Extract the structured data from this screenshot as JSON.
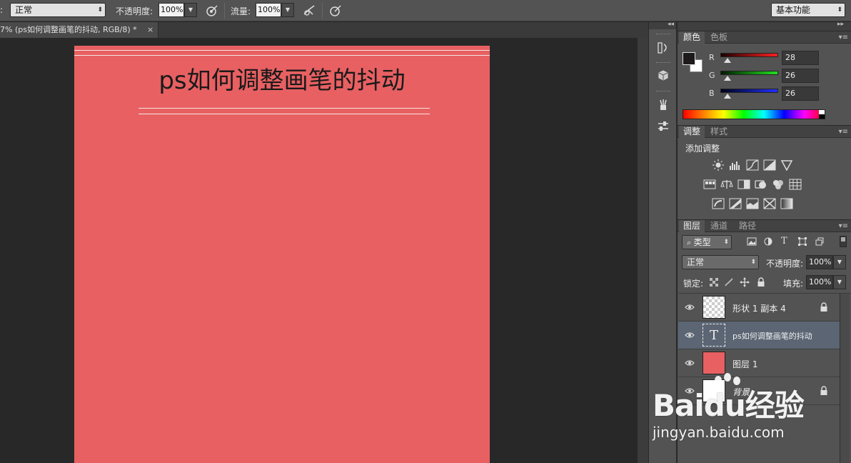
{
  "options_bar": {
    "mode_prefix": ":",
    "mode_value": "正常",
    "opacity_label": "不透明度:",
    "opacity_value": "100%",
    "flow_label": "流量:",
    "flow_value": "100%",
    "workspace": "基本功能"
  },
  "document_tab": {
    "title": "7% (ps如何调整画笔的抖动, RGB/8) *",
    "close": "×"
  },
  "canvas": {
    "title_text": "ps如何调整画笔的抖动",
    "fill_color": "#e86062"
  },
  "color_panel": {
    "tabs": [
      "颜色",
      "色板"
    ],
    "channels": [
      {
        "name": "R",
        "value": "28",
        "track_color": "#e02020"
      },
      {
        "name": "G",
        "value": "26",
        "track_color": "#20c020"
      },
      {
        "name": "B",
        "value": "26",
        "track_color": "#2030e0"
      }
    ],
    "foreground": "#1c1a1a",
    "background": "#ffffff"
  },
  "adjustments_panel": {
    "tabs": [
      "调整",
      "样式"
    ],
    "add_label": "添加调整",
    "icons_row1": [
      "brightness-contrast-icon",
      "levels-icon",
      "curves-icon",
      "exposure-icon",
      "vibrance-icon"
    ],
    "icons_row2": [
      "hue-saturation-icon",
      "color-balance-icon",
      "black-white-icon",
      "photo-filter-icon",
      "channel-mixer-icon",
      "color-lookup-icon"
    ],
    "icons_row3": [
      "invert-icon",
      "posterize-icon",
      "threshold-icon",
      "selective-color-icon",
      "gradient-map-icon"
    ]
  },
  "layers_panel": {
    "tabs": [
      "图层",
      "通道",
      "路径"
    ],
    "filter_kind": "类型",
    "blend_mode": "正常",
    "opacity_label": "不透明度:",
    "opacity_value": "100%",
    "lock_label": "锁定:",
    "fill_label": "填充:",
    "fill_value": "100%",
    "layers": [
      {
        "name": "形状 1 副本 4",
        "thumb": "transparent",
        "locked": true,
        "selected": false
      },
      {
        "name": "ps如何调整画笔的抖动",
        "thumb": "text",
        "locked": false,
        "selected": true
      },
      {
        "name": "图层 1",
        "thumb": "red",
        "locked": false,
        "selected": false
      },
      {
        "name": "背景",
        "thumb": "white",
        "locked": true,
        "selected": false
      }
    ]
  },
  "watermark": {
    "brand": "Baidu经验",
    "url": "jingyan.baidu.com"
  }
}
